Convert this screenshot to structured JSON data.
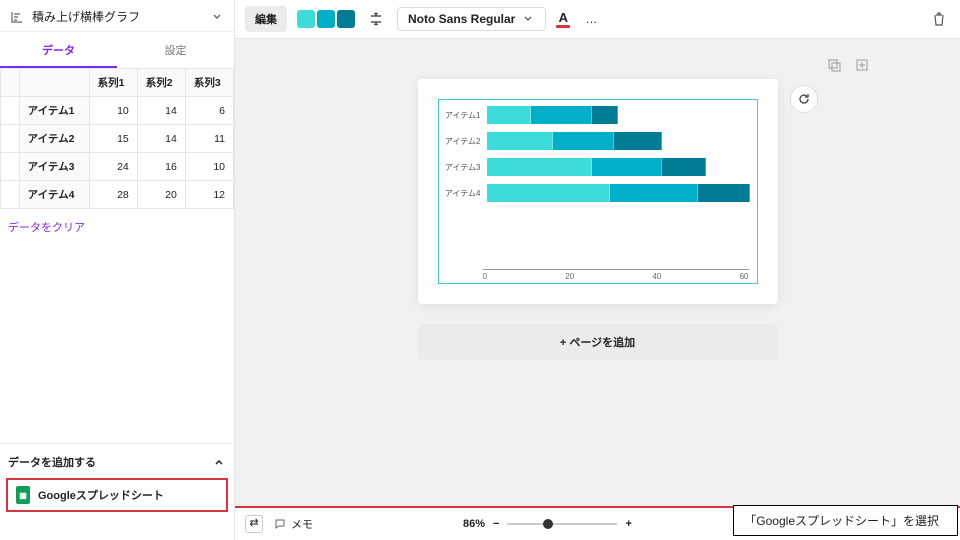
{
  "sidebar": {
    "chart_type_label": "積み上げ横棒グラフ",
    "tabs": {
      "data": "データ",
      "settings": "設定"
    },
    "table": {
      "col_headers": [
        "系列1",
        "系列2",
        "系列3"
      ],
      "row_labels": [
        "アイテム1",
        "アイテム2",
        "アイテム3",
        "アイテム4"
      ],
      "cells": [
        [
          10,
          14,
          6
        ],
        [
          15,
          14,
          11
        ],
        [
          24,
          16,
          10
        ],
        [
          28,
          20,
          12
        ]
      ]
    },
    "clear_data": "データをクリア",
    "add_data_header": "データを追加する",
    "google_sheets": "Googleスプレッドシート"
  },
  "toolbar": {
    "edit_label": "編集",
    "colors": [
      "#3ddbd9",
      "#00b0c8",
      "#007d94"
    ],
    "font_label": "Noto Sans Regular",
    "more": "…",
    "text_underline_color": "#d9333f"
  },
  "canvas": {
    "add_page": "+ ページを追加"
  },
  "footer": {
    "note_label": "メモ",
    "zoom": "86%",
    "slider_pos_pct": 32
  },
  "callout": "「Googleスプレッドシート」を選択",
  "chart_data": {
    "type": "bar",
    "orientation": "horizontal",
    "stacked": true,
    "categories": [
      "アイテム1",
      "アイテム2",
      "アイテム3",
      "アイテム4"
    ],
    "series": [
      {
        "name": "系列1",
        "values": [
          10,
          15,
          24,
          28
        ],
        "color": "#3ddbd9"
      },
      {
        "name": "系列2",
        "values": [
          14,
          14,
          16,
          20
        ],
        "color": "#00b0c8"
      },
      {
        "name": "系列3",
        "values": [
          6,
          11,
          10,
          12
        ],
        "color": "#007d94"
      }
    ],
    "xlim": [
      0,
      60
    ],
    "xticks": [
      0,
      20,
      40,
      60
    ]
  }
}
